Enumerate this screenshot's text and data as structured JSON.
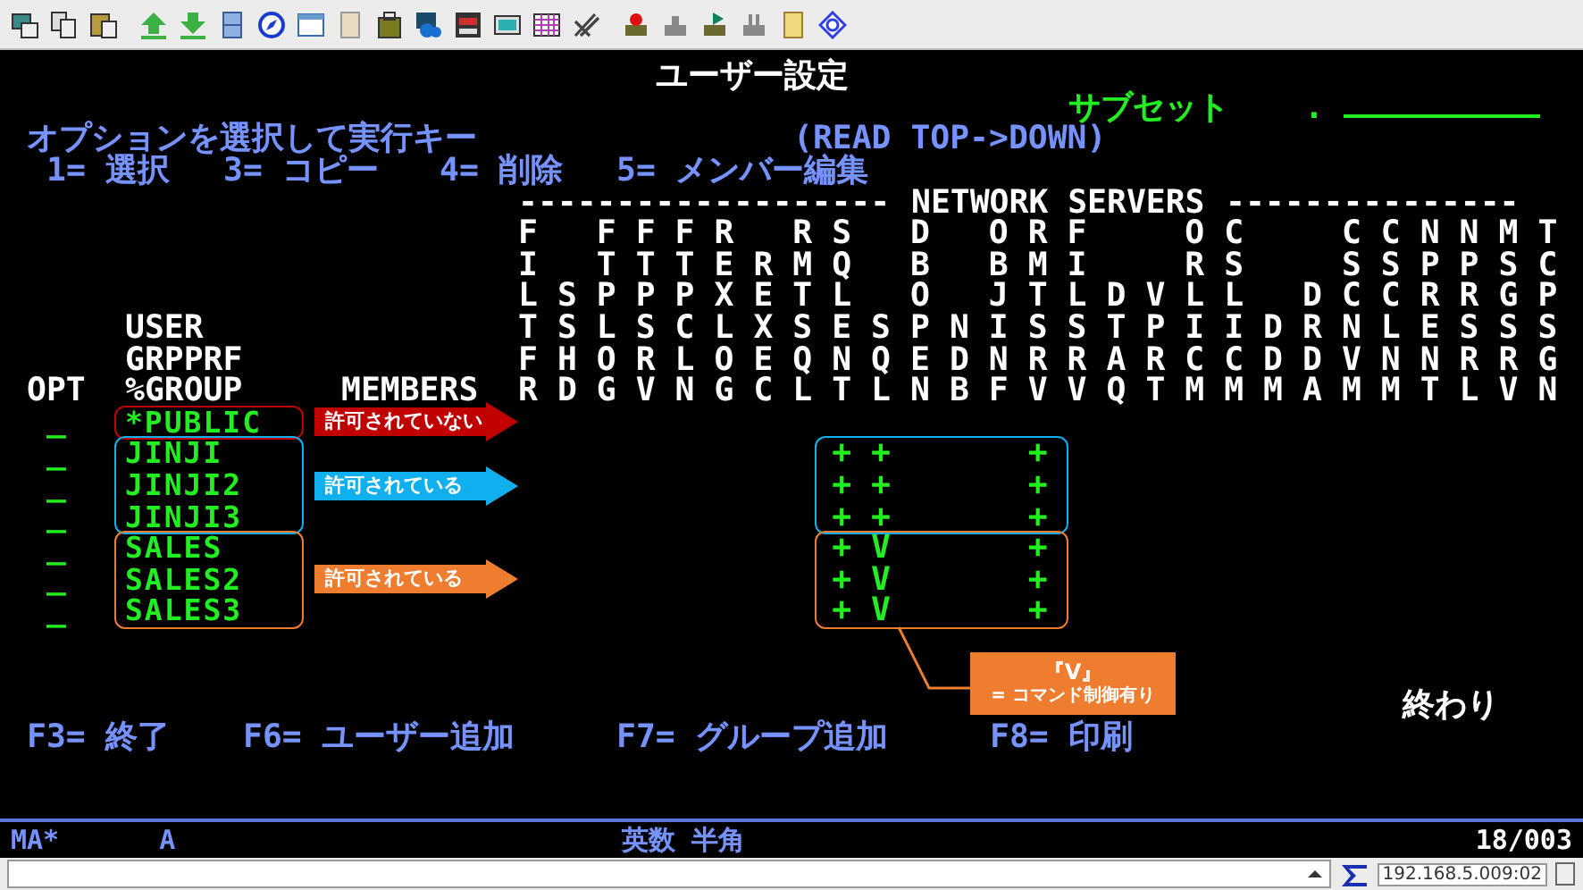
{
  "screen": {
    "title": "ユーザー設定",
    "subset_label": "サブセット",
    "subset_dot": ".",
    "instruction": "オプションを選択して実行キー",
    "read_order": "(READ TOP->DOWN)",
    "options": [
      "1= 選択",
      "3= コピー",
      "4= 削除",
      "5= メンバー編集"
    ],
    "rule_left": "-------------------",
    "network_label": "NETWORK SERVERS",
    "rule_right": "---------------",
    "server_header_lines": [
      "F FFFR RS D ORF  OC  CCNNMT",
      "I TTTERMQ B BMI  RS  SSPPSC",
      "LSPPPXETL O JTLDVLL DCCRRGP",
      "TSLSCLXSESPNISSTPIIDRNLESSS",
      "FHORLOEQNQEDNRRARCCDDVNNRRG",
      "RDGVNGCLTLNBFVVQTMMMAMMTLVN"
    ],
    "headings": {
      "user": "USER",
      "grpprf": "GRPPRF",
      "opt": "OPT",
      "group": "%GROUP",
      "members": "MEMBERS"
    },
    "groups": [
      {
        "color": "#c00000",
        "label": "許可されていない",
        "entries": [
          {
            "opt": "_",
            "name": "*PUBLIC"
          }
        ]
      },
      {
        "color": "#10b0ee",
        "label": "許可されている",
        "entries": [
          {
            "opt": "_",
            "name": "JINJI",
            "flags": "        ++   +"
          },
          {
            "opt": "_",
            "name": "JINJI2",
            "flags": "        ++   +"
          },
          {
            "opt": "_",
            "name": "JINJI3",
            "flags": "        ++   +"
          }
        ]
      },
      {
        "color": "#ee7d30",
        "label": "許可されている",
        "entries": [
          {
            "opt": "_",
            "name": "SALES",
            "flags": "        +V   +"
          },
          {
            "opt": "_",
            "name": "SALES2",
            "flags": "        +V   +"
          },
          {
            "opt": "_",
            "name": "SALES3",
            "flags": "        +V   +"
          }
        ]
      }
    ],
    "callout": {
      "title": "『V』",
      "text": "= コマンド制御有り"
    },
    "end_label": "終わり",
    "function_keys": [
      "F3= 終了",
      "F6= ユーザー追加",
      "F7= グループ追加",
      "F8= 印刷"
    ]
  },
  "status_bar": {
    "mode": "MA*",
    "field": "A",
    "input_mode": "英数 半角",
    "position": "18/003"
  },
  "bottom_bar": {
    "address": "192.168.5.009:02"
  }
}
